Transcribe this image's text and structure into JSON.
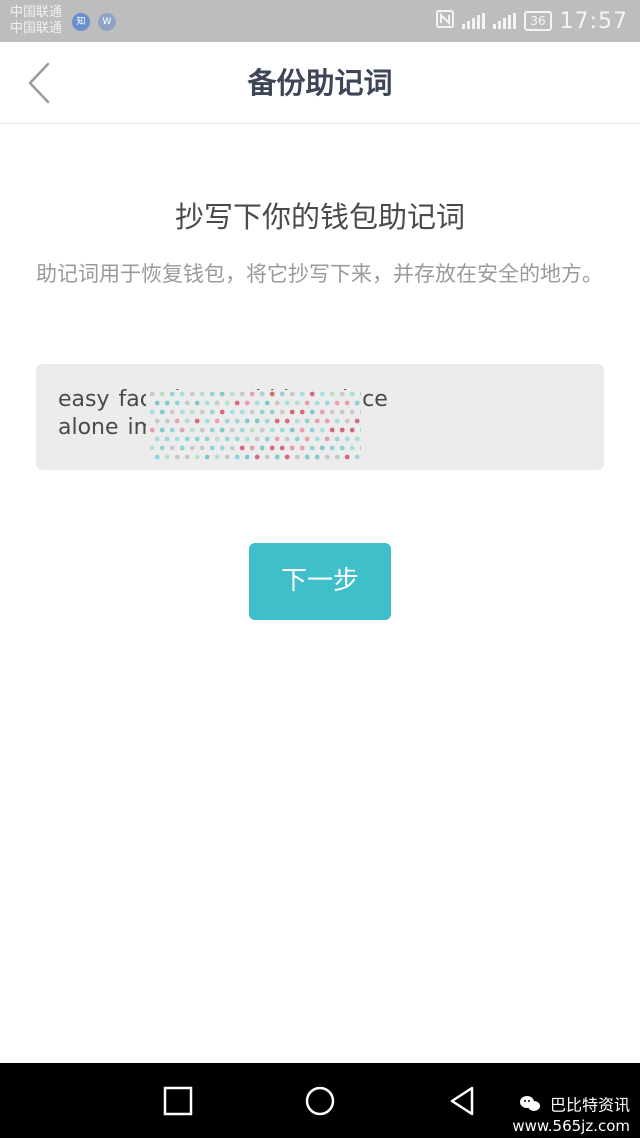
{
  "status_bar": {
    "carrier_line1": "中国联通",
    "carrier_line2": "中国联通",
    "app_badge_1": "知",
    "app_badge_2": "W",
    "battery": "36",
    "time": "17:57"
  },
  "header": {
    "title": "备份助记词"
  },
  "content": {
    "heading": "抄写下你的钱包助记词",
    "description": "助记词用于恢复钱包，将它抄写下来，并存放在安全的地方。",
    "mnemonic_line1": "easy face                      ice art bid produce",
    "mnemonic_line2": "alone imp"
  },
  "actions": {
    "next_label": "下一步"
  },
  "watermark": {
    "name": "巴比特资讯",
    "url": "www.565jz.com"
  },
  "colors": {
    "accent": "#3ebfc9",
    "title_text": "#3d4556",
    "muted_text": "#9a9a9a",
    "mnemonic_bg": "#ececec"
  }
}
